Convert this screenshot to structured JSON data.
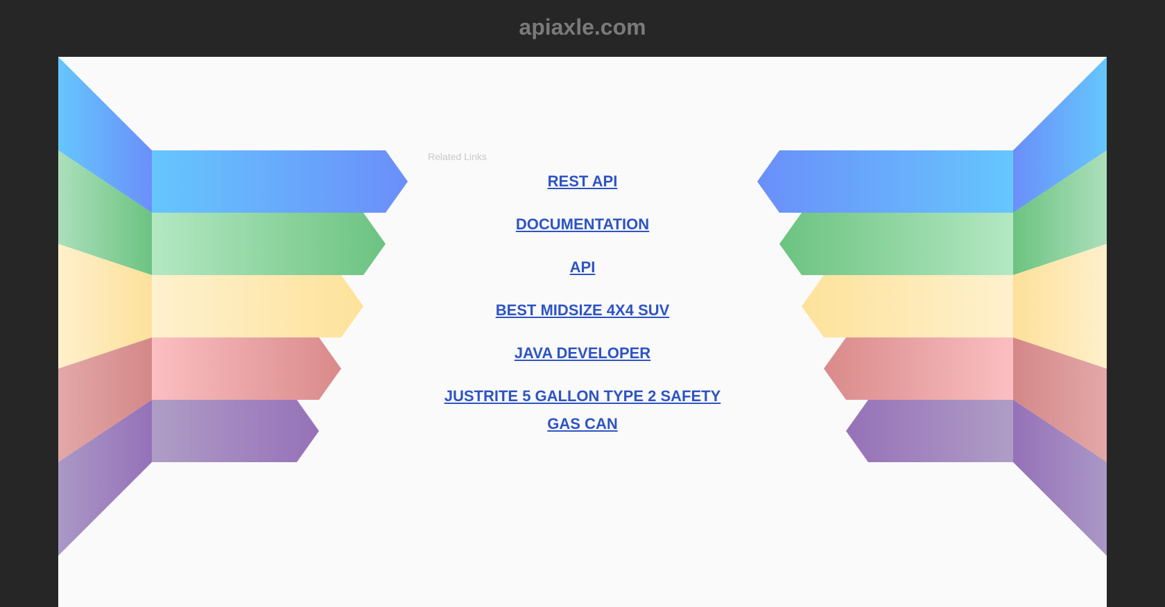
{
  "header": {
    "title": "apiaxle.com"
  },
  "related": {
    "label": "Related Links",
    "links": [
      "REST API",
      "DOCUMENTATION",
      "API",
      "BEST MIDSIZE 4X4 SUV",
      "JAVA DEVELOPER",
      "JUSTRITE 5 GALLON TYPE 2 SAFETY GAS CAN"
    ]
  },
  "colors": {
    "background": "#262626",
    "panel": "#fafafa",
    "link": "#2d53c4",
    "ribbon_blue": "#6a8ffa",
    "ribbon_green": "#6cc381",
    "ribbon_yellow": "#fde29a",
    "ribbon_red": "#dc8e8e",
    "ribbon_purple": "#9673b9"
  }
}
